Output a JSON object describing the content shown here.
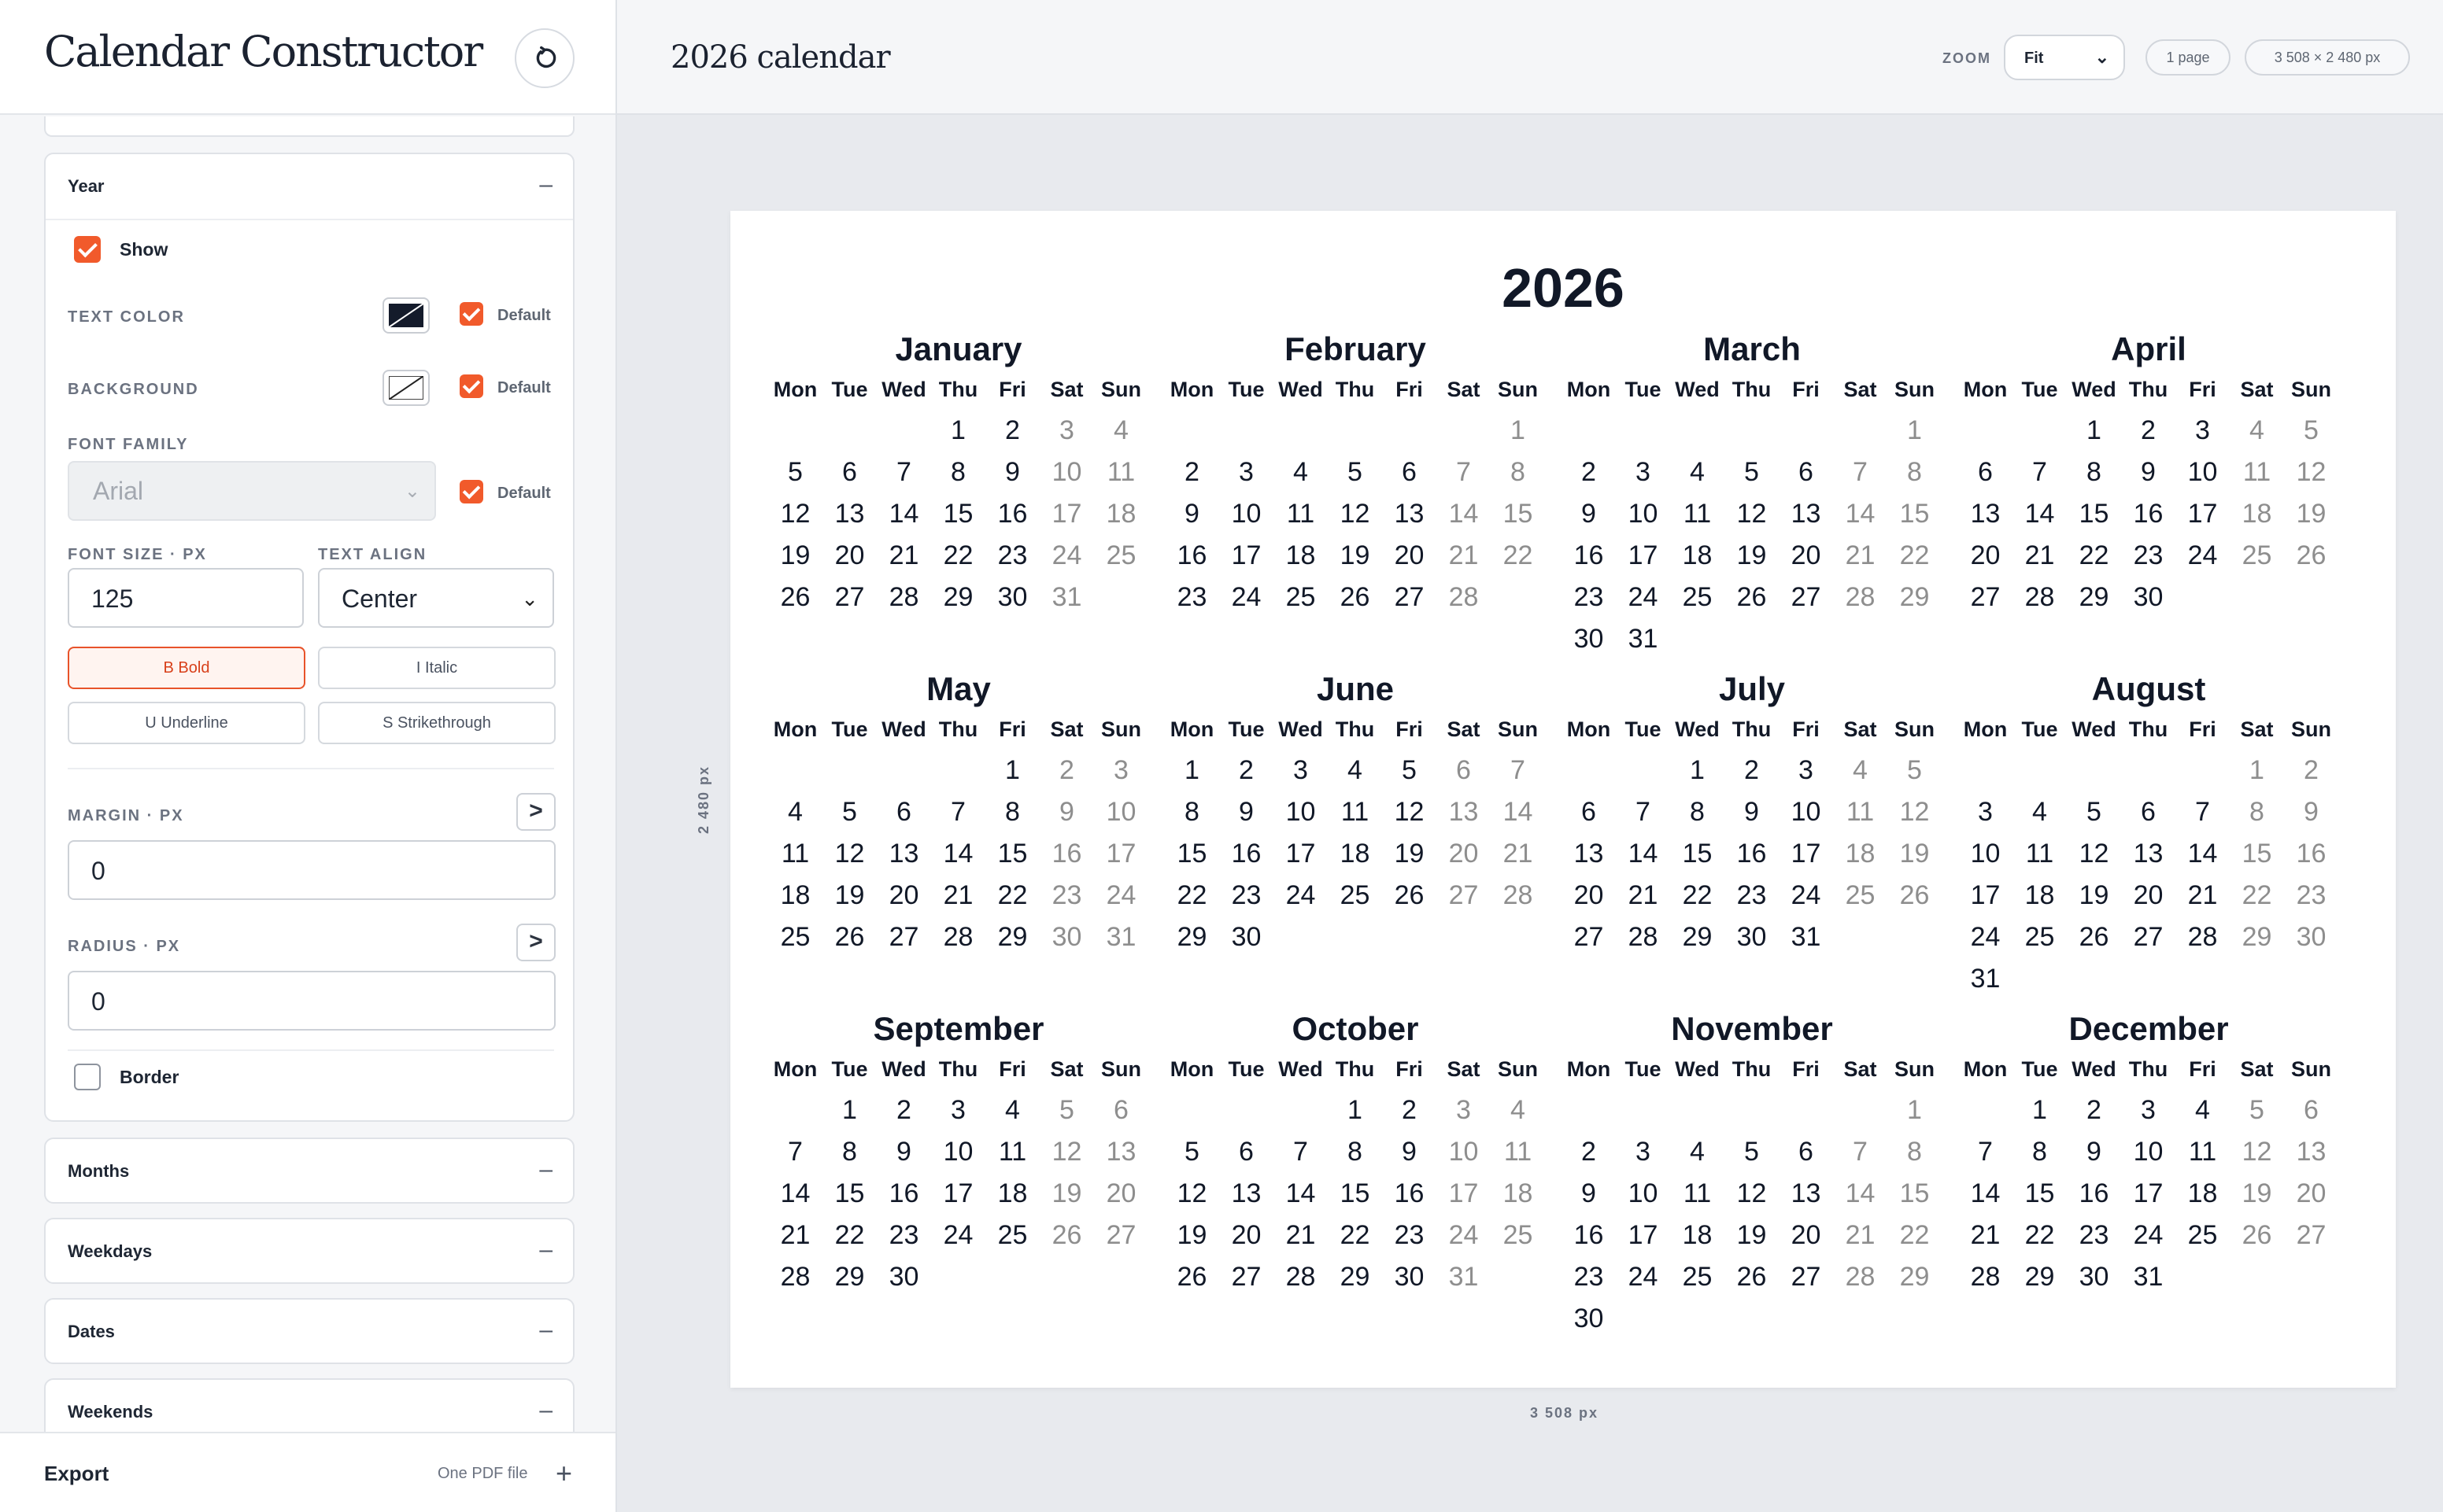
{
  "app": {
    "title": "Calendar Constructor"
  },
  "document": {
    "title": "2026 calendar"
  },
  "toolbar": {
    "zoom_label": "ZOOM",
    "zoom_value": "Fit",
    "pages": "1 page",
    "size": "3 508 × 2 480 px"
  },
  "canvas": {
    "width_label": "3 508 px",
    "height_label": "2 480 px"
  },
  "sidebar": {
    "year_panel": {
      "title": "Year",
      "collapse_icon": "–",
      "show_label": "Show",
      "show_checked": true,
      "text_color_label": "TEXT COLOR",
      "background_label": "BACKGROUND",
      "default_label": "Default",
      "font_family_label": "FONT FAMILY",
      "font_family_value": "Arial",
      "font_size_label": "FONT SIZE · PX",
      "font_size_value": "125",
      "text_align_label": "TEXT ALIGN",
      "text_align_value": "Center",
      "bold_label": "B Bold",
      "italic_label": "I Italic",
      "underline_label": "U Underline",
      "strike_label": "S Strikethrough",
      "margin_label": "MARGIN · PX",
      "margin_value": "0",
      "radius_label": "RADIUS · PX",
      "radius_value": "0",
      "border_label": "Border",
      "border_checked": false,
      "arrow": ">"
    },
    "collapsed_panels": [
      {
        "title": "Months",
        "icon": "–"
      },
      {
        "title": "Weekdays",
        "icon": "–"
      },
      {
        "title": "Dates",
        "icon": "–"
      },
      {
        "title": "Weekends",
        "icon": "–"
      }
    ],
    "export": {
      "label": "Export",
      "sub": "One PDF file",
      "plus": "+"
    }
  },
  "calendar": {
    "year": "2026",
    "weekdays": [
      "Mon",
      "Tue",
      "Wed",
      "Thu",
      "Fri",
      "Sat",
      "Sun"
    ],
    "months": [
      {
        "name": "January",
        "offset": 3,
        "days": 31
      },
      {
        "name": "February",
        "offset": 6,
        "days": 28
      },
      {
        "name": "March",
        "offset": 6,
        "days": 31
      },
      {
        "name": "April",
        "offset": 2,
        "days": 30
      },
      {
        "name": "May",
        "offset": 4,
        "days": 31
      },
      {
        "name": "June",
        "offset": 0,
        "days": 30
      },
      {
        "name": "July",
        "offset": 2,
        "days": 31
      },
      {
        "name": "August",
        "offset": 5,
        "days": 31
      },
      {
        "name": "September",
        "offset": 1,
        "days": 30
      },
      {
        "name": "October",
        "offset": 3,
        "days": 31
      },
      {
        "name": "November",
        "offset": 6,
        "days": 30
      },
      {
        "name": "December",
        "offset": 1,
        "days": 31
      }
    ]
  }
}
